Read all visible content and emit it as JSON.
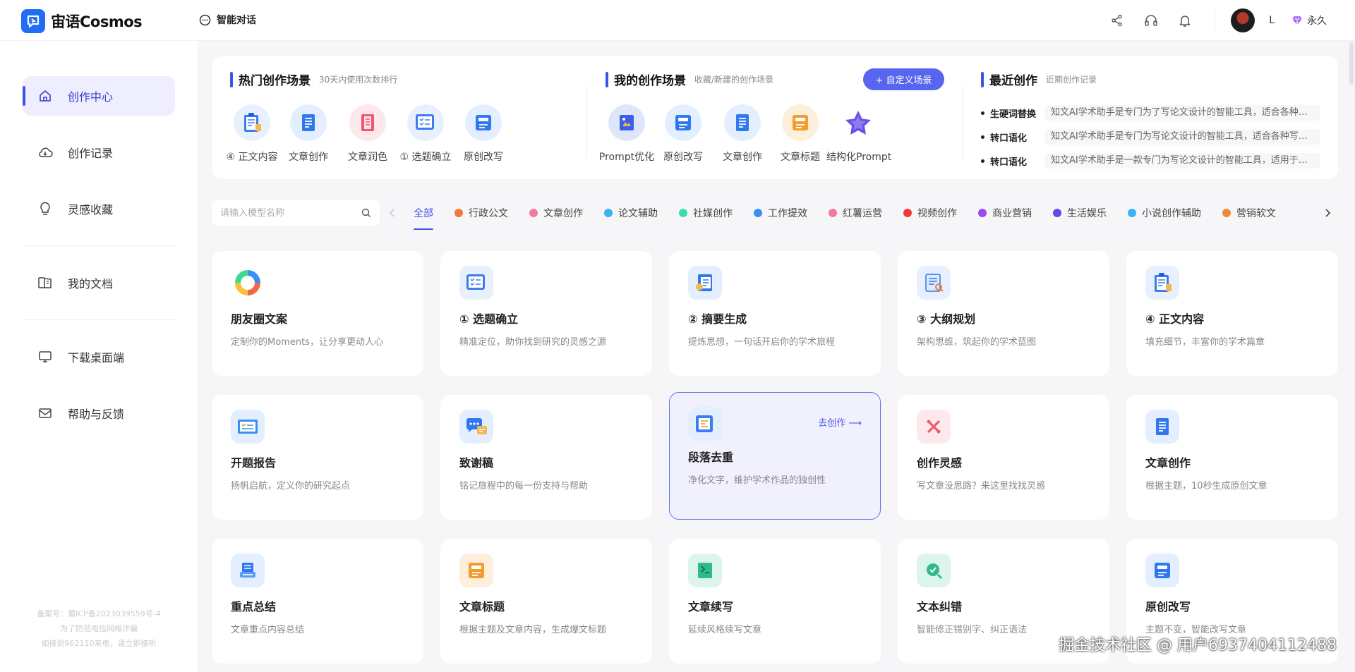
{
  "app": {
    "name": "宙语Cosmos",
    "top_chat_label": "智能对话",
    "user_name": "L",
    "vip_label": "永久"
  },
  "sidebar": {
    "items": [
      {
        "label": "创作中心",
        "icon": "home-icon",
        "active": true
      },
      {
        "label": "创作记录",
        "icon": "cloud-icon"
      },
      {
        "label": "灵感收藏",
        "icon": "bulb-icon"
      },
      {
        "label": "我的文档",
        "icon": "document-icon"
      },
      {
        "label": "下载桌面端",
        "icon": "monitor-icon"
      },
      {
        "label": "帮助与反馈",
        "icon": "mail-icon"
      }
    ],
    "footer": [
      "备案号：蜀ICP备2023039559号-4",
      "为了防范电信网络诈骗",
      "如接到962110来电，请立即接听"
    ]
  },
  "hot_scenes": {
    "title": "热门创作场景",
    "subtitle": "30天内使用次数排行",
    "items": [
      {
        "label": "④ 正文内容",
        "icon": "clipboard-icon",
        "color": "#e8f0fe"
      },
      {
        "label": "文章创作",
        "icon": "article-icon",
        "color": "#e3efff"
      },
      {
        "label": "文章润色",
        "icon": "polish-icon",
        "color": "#fde9ec"
      },
      {
        "label": "① 选题确立",
        "icon": "checklist-icon",
        "color": "#e8f0fe"
      },
      {
        "label": "原创改写",
        "icon": "rewrite-icon",
        "color": "#e3efff"
      }
    ]
  },
  "my_scenes": {
    "title": "我的创作场景",
    "subtitle": "收藏/新建的创作场景",
    "custom_button": "+ 自定义场景",
    "items": [
      {
        "label": "Prompt优化",
        "icon": "prompt-icon",
        "color": "#dfe6fb"
      },
      {
        "label": "原创改写",
        "icon": "rewrite-icon",
        "color": "#e3efff"
      },
      {
        "label": "文章创作",
        "icon": "article-icon",
        "color": "#e3efff"
      },
      {
        "label": "文章标题",
        "icon": "title-icon",
        "color": "#fdefdc"
      },
      {
        "label": "结构化Prompt",
        "icon": "star-icon",
        "color": "#ffffff"
      }
    ]
  },
  "recent": {
    "title": "最近创作",
    "subtitle": "近期创作记录",
    "items": [
      {
        "name": "生硬词替换",
        "text": "知文AI学术助手是专门为了写论文设计的智能工具，适合各种写作需求"
      },
      {
        "name": "转口语化",
        "text": "知文AI学术助手是专门为写论文设计的智能工具，适合各种写作需求"
      },
      {
        "name": "转口语化",
        "text": "知文AI学术助手是一款专门为写论文设计的智能工具，适用于各种写作"
      }
    ]
  },
  "search": {
    "placeholder": "请输入模型名称"
  },
  "categories": [
    {
      "label": "全部",
      "active": true
    },
    {
      "label": "行政公文",
      "color": "#f07a3a"
    },
    {
      "label": "文章创作",
      "color": "#f27a9b"
    },
    {
      "label": "论文辅助",
      "color": "#3db2f0"
    },
    {
      "label": "社媒创作",
      "color": "#3ddbb0"
    },
    {
      "label": "工作提效",
      "color": "#3b8ef2"
    },
    {
      "label": "红薯运营",
      "color": "#f27a9b"
    },
    {
      "label": "视频创作",
      "color": "#ee3c3c"
    },
    {
      "label": "商业营销",
      "color": "#9b4be8"
    },
    {
      "label": "生活娱乐",
      "color": "#5b4be8"
    },
    {
      "label": "小说创作辅助",
      "color": "#3db2f0"
    },
    {
      "label": "营销软文",
      "color": "#f2883a"
    }
  ],
  "cards": [
    {
      "title": "朋友圈文案",
      "desc": "定制你的Moments，让分享更动人心",
      "icon": "ring-icon",
      "color": "#ffffff"
    },
    {
      "title": "① 选题确立",
      "desc": "精准定位，助你找到研究的灵感之源",
      "icon": "checklist-icon",
      "color": "#e8f0fe"
    },
    {
      "title": "② 摘要生成",
      "desc": "提炼思想，一句话开启你的学术旅程",
      "icon": "abstract-icon",
      "color": "#e3efff"
    },
    {
      "title": "③ 大纲规划",
      "desc": "架构思维，筑起你的学术蓝图",
      "icon": "outline-icon",
      "color": "#e8f0fe"
    },
    {
      "title": "④ 正文内容",
      "desc": "填充细节，丰富你的学术篇章",
      "icon": "clipboard-icon",
      "color": "#e8f0fe"
    },
    {
      "title": "开题报告",
      "desc": "扬帆启航，定义你的研究起点",
      "icon": "report-icon",
      "color": "#e3efff"
    },
    {
      "title": "致谢稿",
      "desc": "铭记旅程中的每一份支持与帮助",
      "icon": "chat-icon",
      "color": "#e3efff"
    },
    {
      "title": "段落去重",
      "desc": "净化文字，维护学术作品的独创性",
      "icon": "dedup-icon",
      "color": "#e3efff",
      "go": "去创作 ⟶",
      "highlight": true
    },
    {
      "title": "创作灵感",
      "desc": "写文章没思路？来这里找找灵感",
      "icon": "inspire-icon",
      "color": "#fde9ec"
    },
    {
      "title": "文章创作",
      "desc": "根据主题，10秒生成原创文章",
      "icon": "article-icon",
      "color": "#e3efff"
    },
    {
      "title": "重点总结",
      "desc": "文章重点内容总结",
      "icon": "summary-icon",
      "color": "#e3efff"
    },
    {
      "title": "文章标题",
      "desc": "根据主题及文章内容，生成爆文标题",
      "icon": "title-icon",
      "color": "#fdefdc"
    },
    {
      "title": "文章续写",
      "desc": "延续风格续写文章",
      "icon": "continue-icon",
      "color": "#dcf5ec"
    },
    {
      "title": "文本纠错",
      "desc": "智能修正错别字、纠正语法",
      "icon": "correct-icon",
      "color": "#dcf5ec"
    },
    {
      "title": "原创改写",
      "desc": "主题不变，智能改写文章",
      "icon": "rewrite-icon",
      "color": "#e3efff"
    }
  ],
  "watermark": "掘金技术社区 @ 用户6937404112488"
}
